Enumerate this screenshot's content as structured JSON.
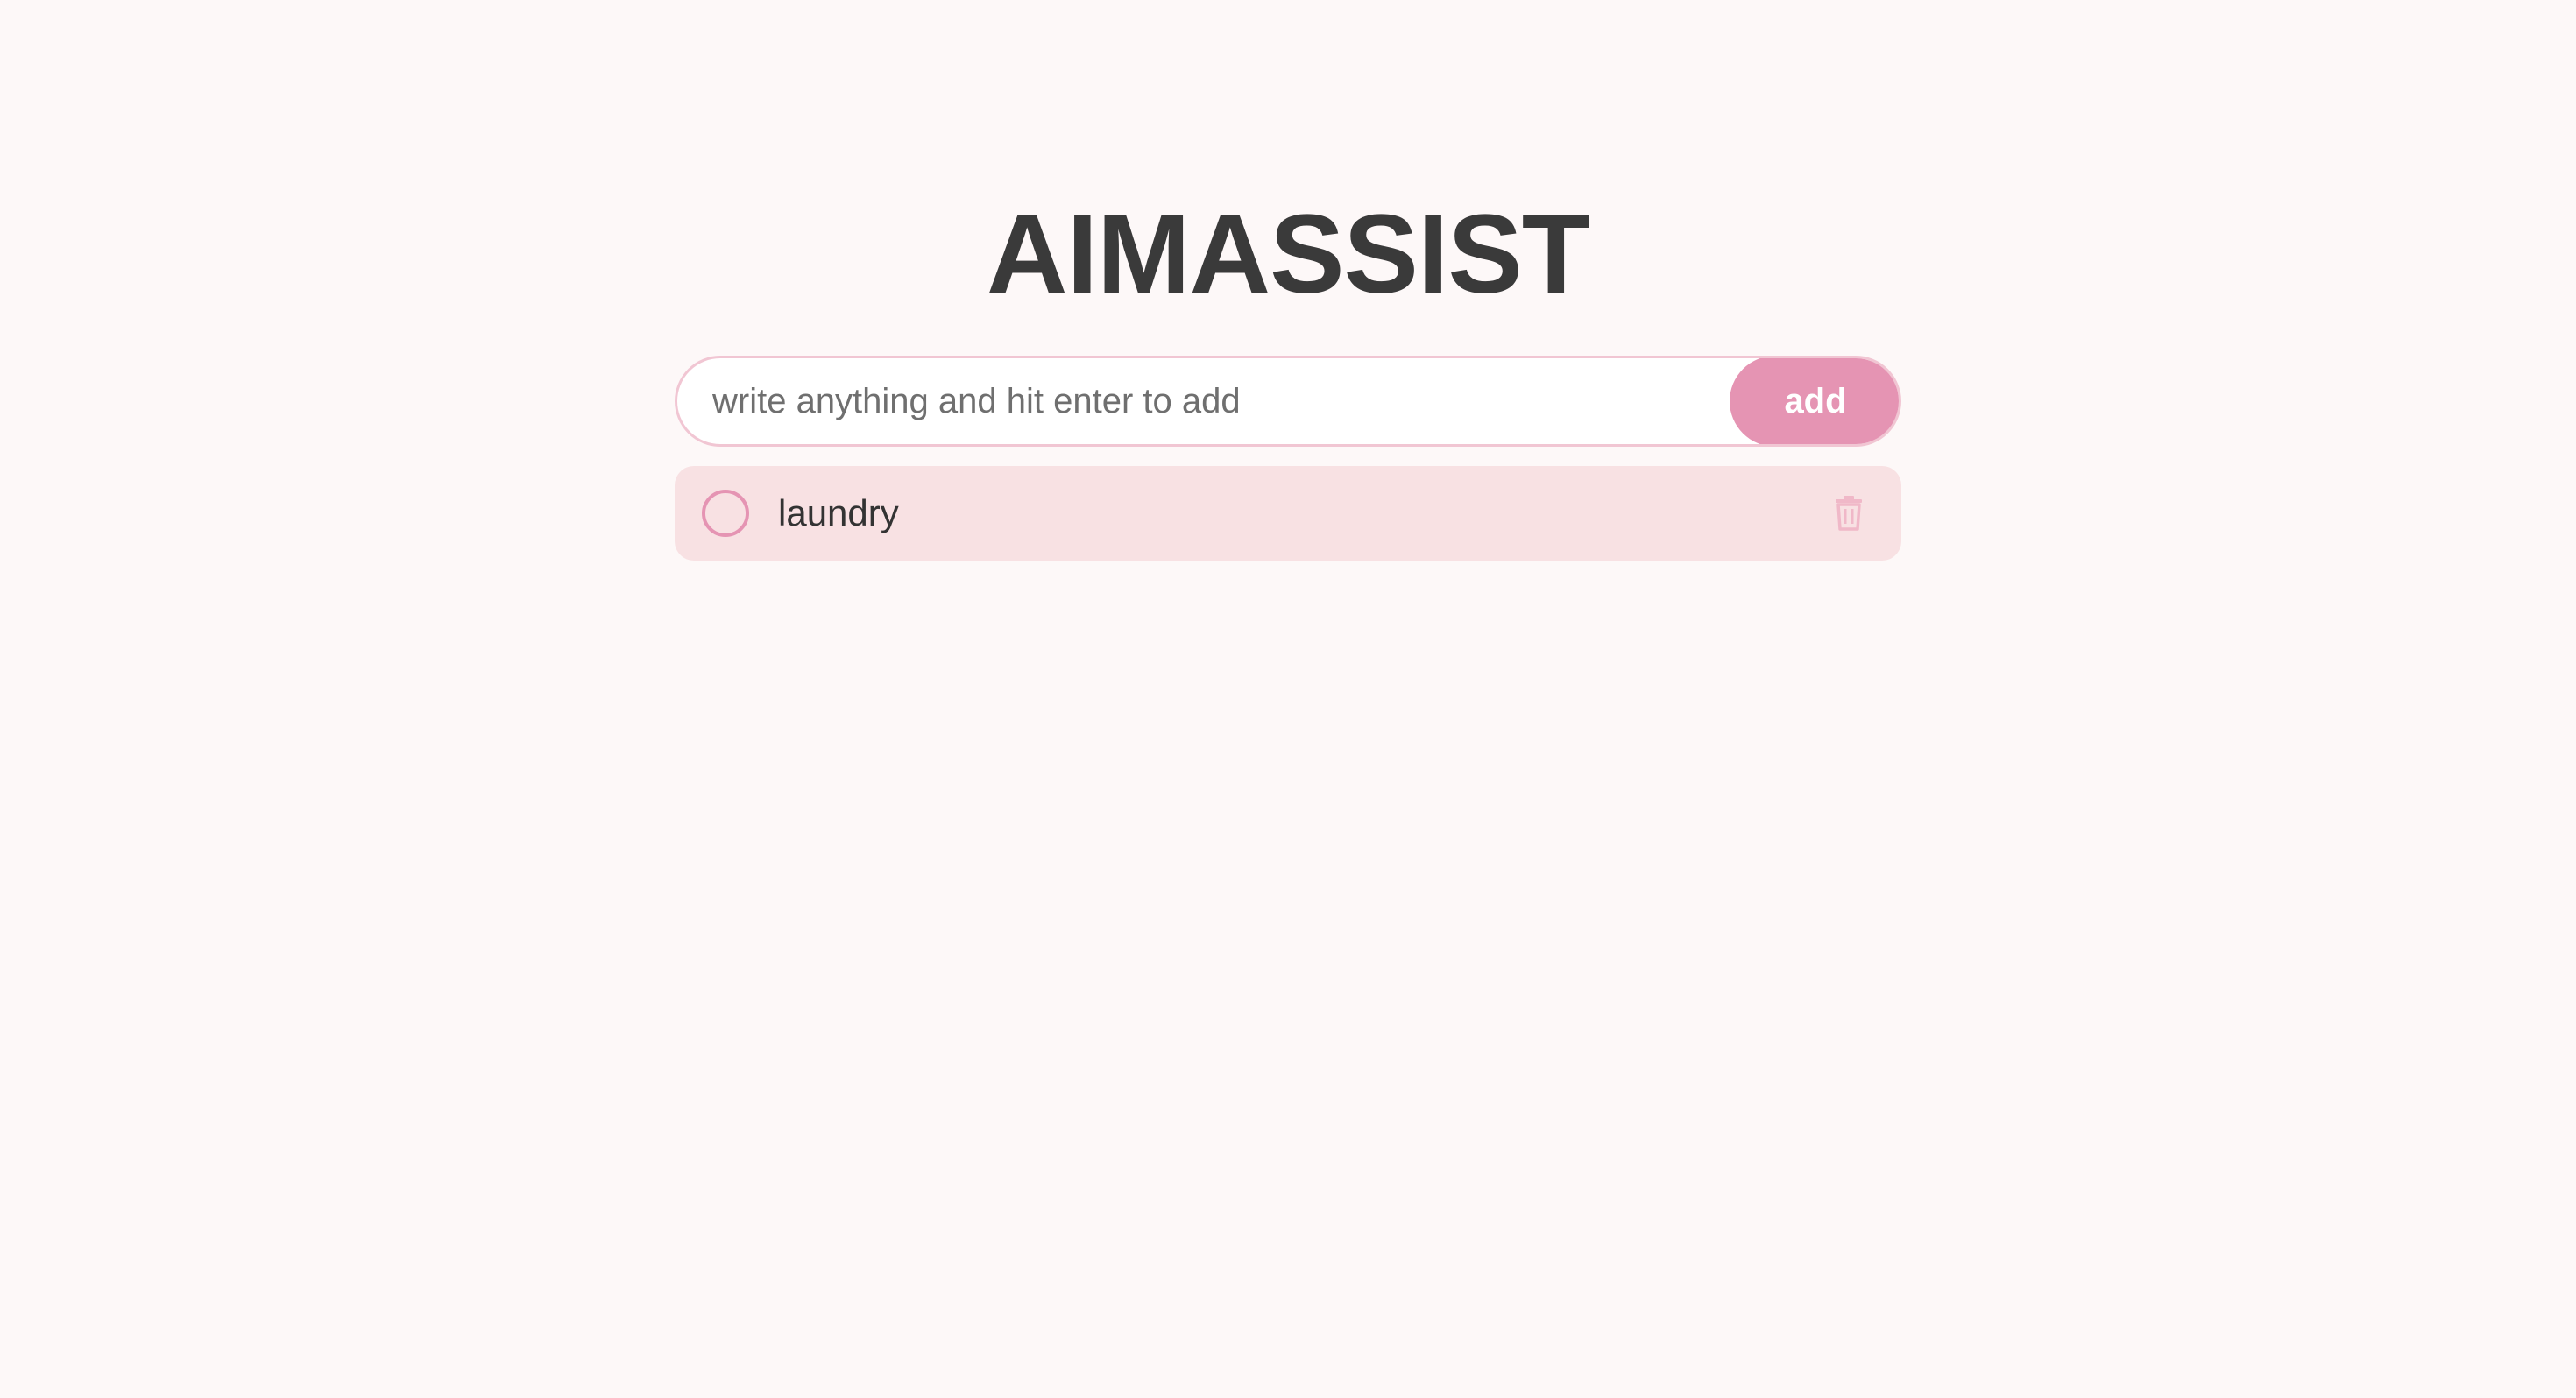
{
  "header": {
    "title": "AIMASSIST"
  },
  "input": {
    "placeholder": "write anything and hit enter to add",
    "value": "",
    "add_label": "add"
  },
  "todos": [
    {
      "text": "laundry",
      "completed": false
    }
  ],
  "icons": {
    "check": "empty-circle",
    "delete": "trash-icon"
  },
  "colors": {
    "background": "#fdf8f8",
    "accent": "#e594b3",
    "item_background": "#f8e1e3",
    "input_border": "#f1c6d3",
    "title": "#3a3a3a",
    "delete_icon": "#f0b8c8"
  }
}
